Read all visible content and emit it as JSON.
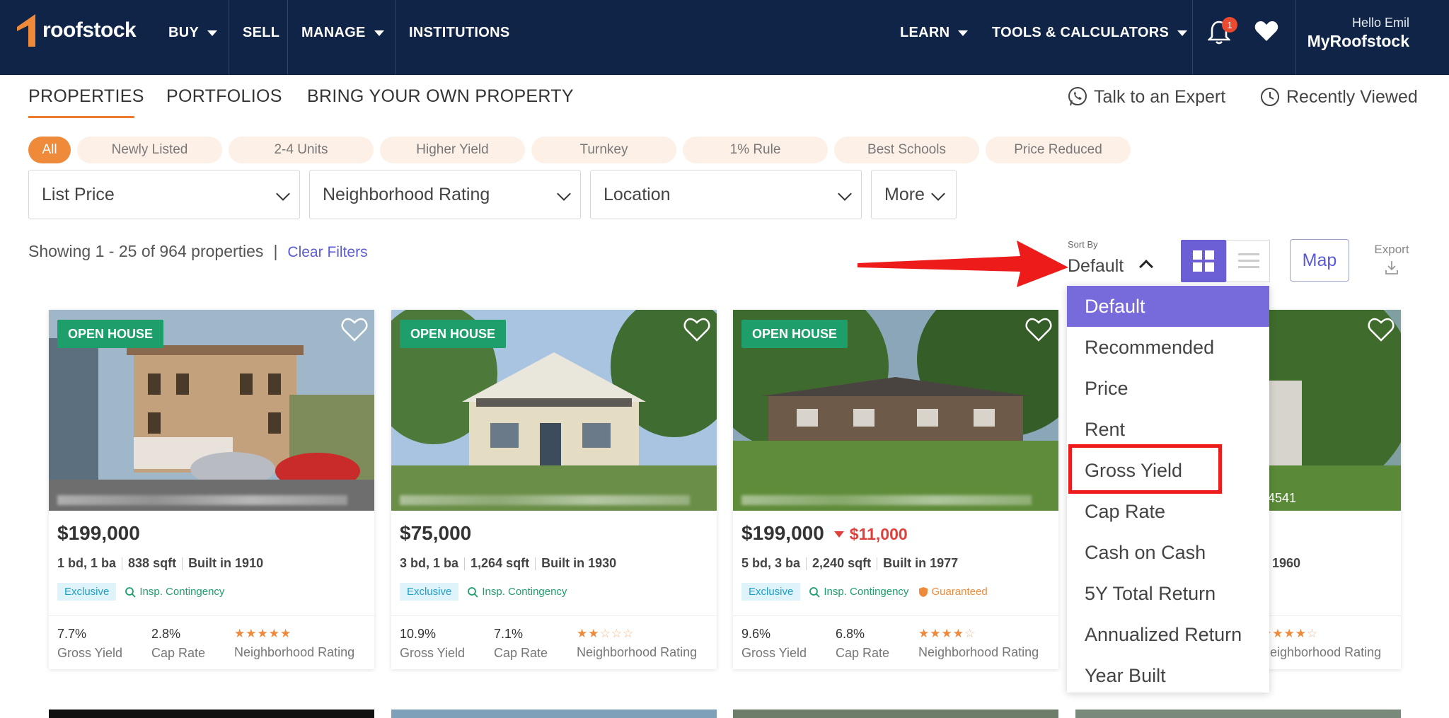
{
  "nav": {
    "brand": "roofstock",
    "items": [
      "BUY",
      "SELL",
      "MANAGE",
      "INSTITUTIONS"
    ],
    "right_items": [
      "LEARN",
      "TOOLS & CALCULATORS"
    ],
    "notif_count": "1",
    "greeting": "Hello Emil",
    "account": "MyRoofstock"
  },
  "subtabs": [
    "PROPERTIES",
    "PORTFOLIOS",
    "BRING YOUR OWN PROPERTY"
  ],
  "links": {
    "expert": "Talk to an Expert",
    "recent": "Recently Viewed"
  },
  "chips": [
    "All",
    "Newly Listed",
    "2-4 Units",
    "Higher Yield",
    "Turnkey",
    "1% Rule",
    "Best Schools",
    "Price Reduced"
  ],
  "filters": [
    "List Price",
    "Neighborhood Rating",
    "Location",
    "More"
  ],
  "results": {
    "showing": "Showing 1 - 25 of 964 properties",
    "sep": "|",
    "clear": "Clear Filters"
  },
  "sort": {
    "label": "Sort By",
    "value": "Default"
  },
  "map_label": "Map",
  "export_label": "Export",
  "sort_options": [
    "Default",
    "Recommended",
    "Price",
    "Rent",
    "Gross Yield",
    "Cap Rate",
    "Cash on Cash",
    "5Y Total Return",
    "Annualized Return",
    "Year Built"
  ],
  "cards": [
    {
      "badge": "OPEN HOUSE",
      "price": "$199,000",
      "beds": "1 bd, 1 ba",
      "sqft": "838 sqft",
      "built": "Built in 1910",
      "tag_excl": "Exclusive",
      "tag_insp": "Insp. Contingency",
      "gross": "7.7%",
      "cap": "2.8%",
      "rating": 5,
      "gross_label": "Gross Yield",
      "cap_label": "Cap Rate",
      "rating_label": "Neighborhood Rating"
    },
    {
      "badge": "OPEN HOUSE",
      "price": "$75,000",
      "beds": "3 bd, 1 ba",
      "sqft": "1,264 sqft",
      "built": "Built in 1930",
      "tag_excl": "Exclusive",
      "tag_insp": "Insp. Contingency",
      "gross": "10.9%",
      "cap": "7.1%",
      "rating": 2,
      "gross_label": "Gross Yield",
      "cap_label": "Cap Rate",
      "rating_label": "Neighborhood Rating"
    },
    {
      "badge": "OPEN HOUSE",
      "price": "$199,000",
      "drop": "$11,000",
      "beds": "5 bd, 3 ba",
      "sqft": "2,240 sqft",
      "built": "Built in 1977",
      "tag_excl": "Exclusive",
      "tag_insp": "Insp. Contingency",
      "tag_guar": "Guaranteed",
      "gross": "9.6%",
      "cap": "6.8%",
      "rating": 3.5,
      "gross_label": "Gross Yield",
      "cap_label": "Cap Rate",
      "rating_label": "Neighborhood Rating"
    },
    {
      "addr_tail": "24541",
      "built": "n 1960",
      "rating": 4,
      "rating_label": "Neighborhood Rating"
    }
  ],
  "colors": {
    "nav_bg": "#0f2446",
    "accent": "#ef8a3b",
    "purple": "#776bdc",
    "highlight": "#ee1b1b"
  }
}
